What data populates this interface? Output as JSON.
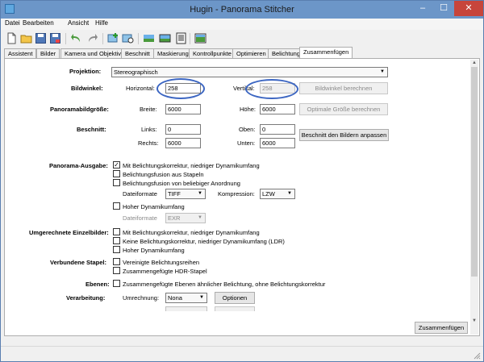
{
  "window": {
    "title": "Hugin - Panorama Stitcher",
    "controls": {
      "minimize": "–",
      "maximize": "☐",
      "close": "✕"
    }
  },
  "menu": [
    "Datei",
    "Bearbeiten",
    "Ansicht",
    "Hilfe"
  ],
  "tabs": [
    "Assistent",
    "Bilder",
    "Kamera und Objektiv",
    "Beschnitt",
    "Maskierung",
    "Kontrollpunkte",
    "Optimieren",
    "Belichtung",
    "Zusammenfügen"
  ],
  "active_tab": "Zusammenfügen",
  "projection": {
    "label": "Projektion:",
    "value": "Stereographisch"
  },
  "fov": {
    "label": "Bildwinkel:",
    "horizontal_label": "Horizontal:",
    "horizontal_value": "258",
    "vertical_label": "Vertikal:",
    "vertical_value": "258",
    "calc_button": "Bildwinkel berechnen"
  },
  "canvas": {
    "label": "Panoramabildgröße:",
    "width_label": "Breite:",
    "width_value": "6000",
    "height_label": "Höhe:",
    "height_value": "6000",
    "optimal_button": "Optimale Größe berechnen"
  },
  "crop": {
    "label": "Beschnitt:",
    "left_label": "Links:",
    "left_value": "0",
    "top_label": "Oben:",
    "top_value": "0",
    "right_label": "Rechts:",
    "right_value": "6000",
    "bottom_label": "Unten:",
    "bottom_value": "6000",
    "fit_button": "Beschnitt den Bildern anpassen"
  },
  "panorama_output": {
    "label": "Panorama-Ausgabe:",
    "options": [
      {
        "text": "Mit Belichtungskorrektur, niedriger Dynamikumfang",
        "checked": true
      },
      {
        "text": "Belichtungsfusion aus Stapeln",
        "checked": false
      },
      {
        "text": "Belichtungsfusion von beliebiger Anordnung",
        "checked": false
      }
    ],
    "format_label": "Dateiformate",
    "format_value": "TIFF",
    "compression_label": "Kompression:",
    "compression_value": "LZW",
    "hdr_option": "Hoher Dynamikumfang",
    "hdr_format_label": "Dateiformate",
    "hdr_format_value": "EXR"
  },
  "remapped": {
    "label": "Umgerechnete Einzelbilder:",
    "options": [
      "Mit Belichtungskorrektur, niedriger Dynamikumfang",
      "Keine Belichtungskorrektur, niedriger Dynamikumfang (LDR)",
      "Hoher Dynamikumfang"
    ]
  },
  "stacks": {
    "label": "Verbundene Stapel:",
    "options": [
      "Vereinigte Belichtungsreihen",
      "Zusammengefügte HDR-Stapel"
    ]
  },
  "layers": {
    "label": "Ebenen:",
    "option": "Zusammengefügte Ebenen ähnlicher Belichtung, ohne Belichtungskorrektur"
  },
  "processing": {
    "label": "Verarbeitung:",
    "remap_label": "Umrechnung:",
    "remap_value": "Nona",
    "options_button": "Optionen"
  },
  "stitch_button": "Zusammenfügen",
  "highlight_color": "#3c66c2"
}
